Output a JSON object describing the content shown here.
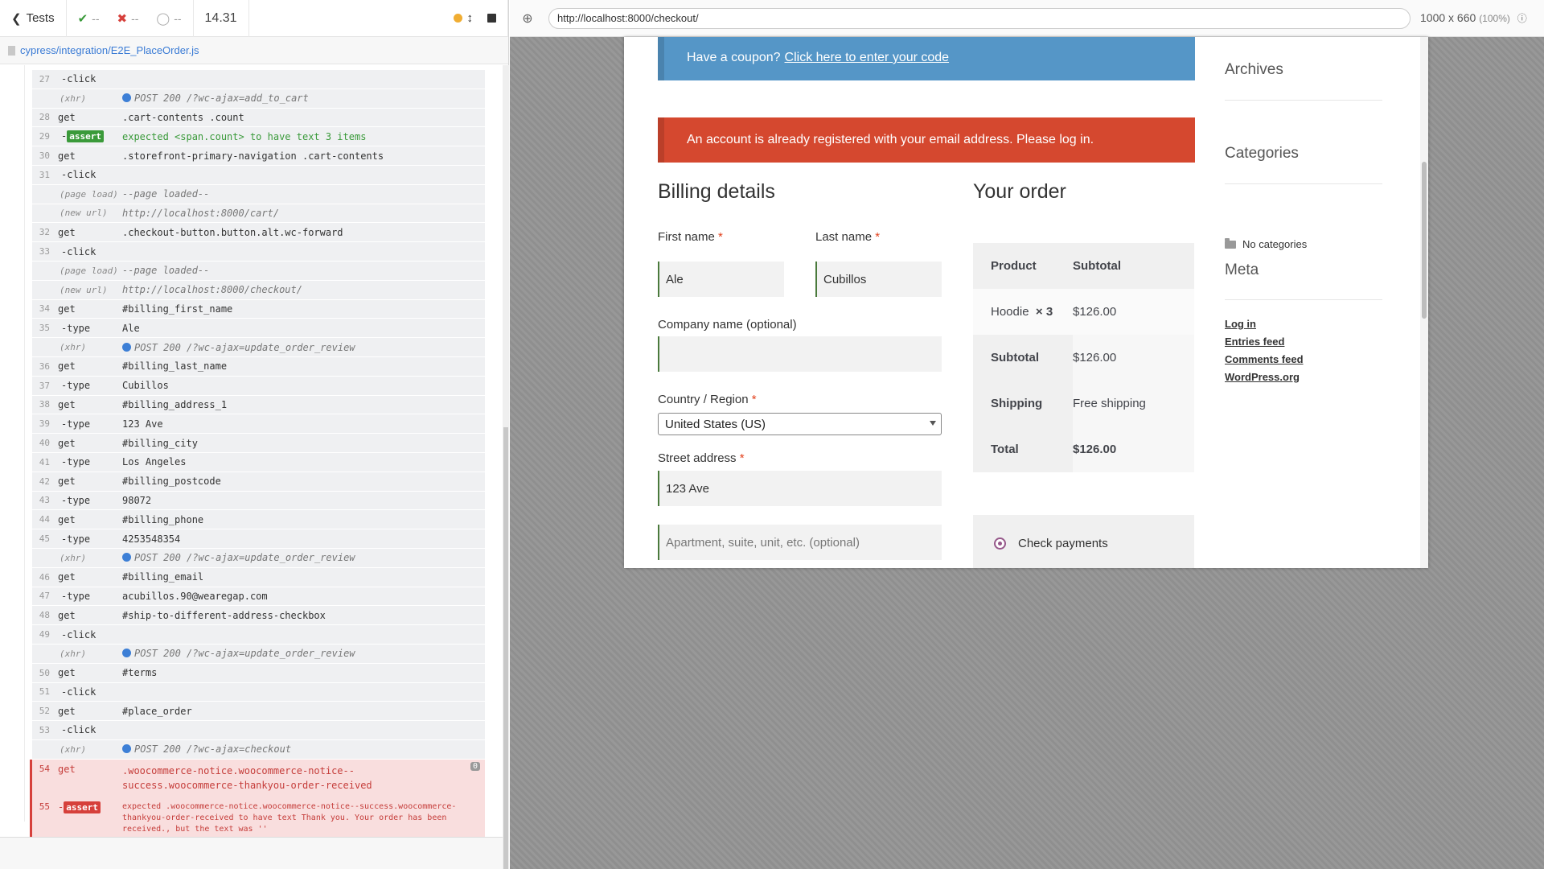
{
  "topbar": {
    "tests_label": "Tests",
    "passed": "--",
    "failed": "--",
    "pending": "--",
    "duration": "14.31"
  },
  "spec_file": "cypress/integration/E2E_PlaceOrder.js",
  "commands": [
    {
      "num": "27",
      "name": "-click",
      "message": "",
      "kind": "child"
    },
    {
      "num": "",
      "name": "(xhr)",
      "message": "POST 200 /?wc-ajax=add_to_cart",
      "kind": "xhr"
    },
    {
      "num": "28",
      "name": "get",
      "message": ".cart-contents .count",
      "kind": "cmd"
    },
    {
      "num": "29",
      "name": "-",
      "badge": "assert",
      "message": "expected <span.count> to have text 3 items",
      "kind": "assert"
    },
    {
      "num": "30",
      "name": "get",
      "message": ".storefront-primary-navigation .cart-contents",
      "kind": "cmd"
    },
    {
      "num": "31",
      "name": "-click",
      "message": "",
      "kind": "child"
    },
    {
      "num": "",
      "name": "(page load)",
      "message": "--page loaded--",
      "kind": "event"
    },
    {
      "num": "",
      "name": "(new url)",
      "message": "http://localhost:8000/cart/",
      "kind": "event"
    },
    {
      "num": "32",
      "name": "get",
      "message": ".checkout-button.button.alt.wc-forward",
      "kind": "cmd"
    },
    {
      "num": "33",
      "name": "-click",
      "message": "",
      "kind": "child"
    },
    {
      "num": "",
      "name": "(page load)",
      "message": "--page loaded--",
      "kind": "event"
    },
    {
      "num": "",
      "name": "(new url)",
      "message": "http://localhost:8000/checkout/",
      "kind": "event"
    },
    {
      "num": "34",
      "name": "get",
      "message": "#billing_first_name",
      "kind": "cmd"
    },
    {
      "num": "35",
      "name": "-type",
      "message": "Ale",
      "kind": "child"
    },
    {
      "num": "",
      "name": "(xhr)",
      "message": "POST 200 /?wc-ajax=update_order_review",
      "kind": "xhr"
    },
    {
      "num": "36",
      "name": "get",
      "message": "#billing_last_name",
      "kind": "cmd"
    },
    {
      "num": "37",
      "name": "-type",
      "message": "Cubillos",
      "kind": "child"
    },
    {
      "num": "38",
      "name": "get",
      "message": "#billing_address_1",
      "kind": "cmd"
    },
    {
      "num": "39",
      "name": "-type",
      "message": "123 Ave",
      "kind": "child"
    },
    {
      "num": "40",
      "name": "get",
      "message": "#billing_city",
      "kind": "cmd"
    },
    {
      "num": "41",
      "name": "-type",
      "message": "Los Angeles",
      "kind": "child"
    },
    {
      "num": "42",
      "name": "get",
      "message": "#billing_postcode",
      "kind": "cmd"
    },
    {
      "num": "43",
      "name": "-type",
      "message": "98072",
      "kind": "child"
    },
    {
      "num": "44",
      "name": "get",
      "message": "#billing_phone",
      "kind": "cmd"
    },
    {
      "num": "45",
      "name": "-type",
      "message": "4253548354",
      "kind": "child"
    },
    {
      "num": "",
      "name": "(xhr)",
      "message": "POST 200 /?wc-ajax=update_order_review",
      "kind": "xhr"
    },
    {
      "num": "46",
      "name": "get",
      "message": "#billing_email",
      "kind": "cmd"
    },
    {
      "num": "47",
      "name": "-type",
      "message": "acubillos.90@wearegap.com",
      "kind": "child"
    },
    {
      "num": "48",
      "name": "get",
      "message": "#ship-to-different-address-checkbox",
      "kind": "cmd"
    },
    {
      "num": "49",
      "name": "-click",
      "message": "",
      "kind": "child"
    },
    {
      "num": "",
      "name": "(xhr)",
      "message": "POST 200 /?wc-ajax=update_order_review",
      "kind": "xhr"
    },
    {
      "num": "50",
      "name": "get",
      "message": "#terms",
      "kind": "cmd"
    },
    {
      "num": "51",
      "name": "-click",
      "message": "",
      "kind": "child"
    },
    {
      "num": "52",
      "name": "get",
      "message": "#place_order",
      "kind": "cmd"
    },
    {
      "num": "53",
      "name": "-click",
      "message": "",
      "kind": "child"
    },
    {
      "num": "",
      "name": "(xhr)",
      "message": "POST 200 /?wc-ajax=checkout",
      "kind": "xhr"
    }
  ],
  "error_commands": [
    {
      "num": "54",
      "name": "get",
      "message": ".woocommerce-notice.woocommerce-notice--success.woocommerce-thankyou-order-received",
      "pin": "0"
    },
    {
      "num": "55",
      "name": "-",
      "badge": "assert",
      "message": "expected .woocommerce-notice.woocommerce-notice--success.woocommerce-thankyou-order-received to have text Thank you. Your order has been received., but the text was ''"
    }
  ],
  "browser": {
    "url": "http://localhost:8000/checkout/",
    "viewport": "1000 x 660",
    "scale": "(100%)"
  },
  "page": {
    "coupon_text": "Have a coupon?",
    "coupon_link": "Click here to enter your code",
    "error_notice": "An account is already registered with your email address. Please log in.",
    "billing_heading": "Billing details",
    "first_name_label": "First name",
    "last_name_label": "Last name",
    "required_mark": "*",
    "first_name_value": "Ale",
    "last_name_value": "Cubillos",
    "company_label": "Company name (optional)",
    "company_value": "",
    "country_label": "Country / Region",
    "country_value": "United States (US)",
    "street_label": "Street address",
    "street_value": "123 Ave",
    "apartment_placeholder": "Apartment, suite, unit, etc. (optional)",
    "order_heading": "Your order",
    "order_table": {
      "col_product": "Product",
      "col_subtotal": "Subtotal",
      "item_name": "Hoodie",
      "item_qty": "× 3",
      "item_total": "$126.00",
      "subtotal_label": "Subtotal",
      "subtotal_value": "$126.00",
      "shipping_label": "Shipping",
      "shipping_value": "Free shipping",
      "total_label": "Total",
      "total_value": "$126.00"
    },
    "payment_method": "Check payments",
    "sidebar": {
      "archives": "Archives",
      "categories": "Categories",
      "no_categories": "No categories",
      "meta": "Meta",
      "links": [
        "Log in",
        "Entries feed",
        "Comments feed",
        "WordPress.org"
      ]
    }
  },
  "colors": {
    "coupon_bg": "#5596c7",
    "error_bg": "#d5482f",
    "pass": "#3a9a3a",
    "fail": "#d6403b",
    "xhr": "#3d7fd6",
    "running": "#f0ad32"
  }
}
